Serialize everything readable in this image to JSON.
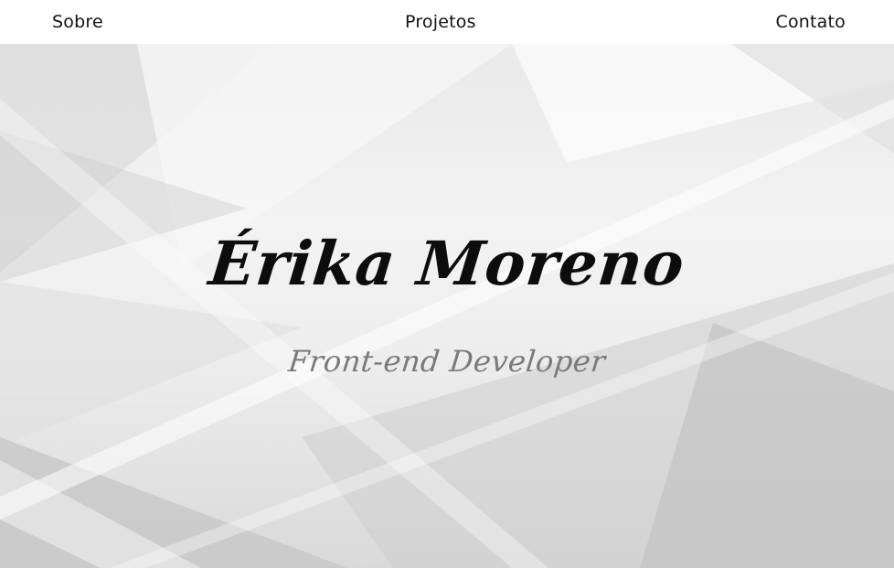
{
  "nav": {
    "items": [
      {
        "label": "Sobre"
      },
      {
        "label": "Projetos"
      },
      {
        "label": "Contato"
      }
    ]
  },
  "hero": {
    "name": "Érika Moreno",
    "role": "Front-end Developer"
  },
  "colors": {
    "nav_background": "#ffffff",
    "nav_text": "#111111",
    "name_text": "#0d0d0d",
    "role_text": "#7a7a7a"
  }
}
